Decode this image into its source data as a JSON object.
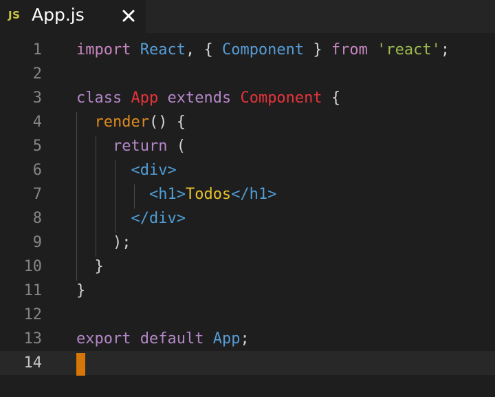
{
  "tab": {
    "lang_badge": "JS",
    "title": "App.js",
    "close_icon": "close-icon"
  },
  "editor": {
    "current_line": 14,
    "lines": [
      {
        "n": "1",
        "tokens": [
          {
            "t": "import",
            "c": "kw"
          },
          {
            "t": " ",
            "c": "pn"
          },
          {
            "t": "React",
            "c": "id"
          },
          {
            "t": ", { ",
            "c": "pn"
          },
          {
            "t": "Component",
            "c": "id"
          },
          {
            "t": " } ",
            "c": "pn"
          },
          {
            "t": "from",
            "c": "kw"
          },
          {
            "t": " ",
            "c": "pn"
          },
          {
            "t": "'react'",
            "c": "str"
          },
          {
            "t": ";",
            "c": "pn"
          }
        ]
      },
      {
        "n": "2",
        "tokens": []
      },
      {
        "n": "3",
        "tokens": [
          {
            "t": "class",
            "c": "kw2"
          },
          {
            "t": " ",
            "c": "pn"
          },
          {
            "t": "App",
            "c": "cls"
          },
          {
            "t": " ",
            "c": "pn"
          },
          {
            "t": "extends",
            "c": "kw2"
          },
          {
            "t": " ",
            "c": "pn"
          },
          {
            "t": "Component",
            "c": "cls"
          },
          {
            "t": " {",
            "c": "pn"
          }
        ]
      },
      {
        "n": "4",
        "tokens": [
          {
            "t": "  ",
            "c": "pn"
          },
          {
            "t": "render",
            "c": "fn"
          },
          {
            "t": "() {",
            "c": "pn"
          }
        ]
      },
      {
        "n": "5",
        "tokens": [
          {
            "t": "    ",
            "c": "pn"
          },
          {
            "t": "return",
            "c": "kw2"
          },
          {
            "t": " (",
            "c": "pn"
          }
        ]
      },
      {
        "n": "6",
        "tokens": [
          {
            "t": "      ",
            "c": "pn"
          },
          {
            "t": "<div>",
            "c": "tag"
          }
        ]
      },
      {
        "n": "7",
        "tokens": [
          {
            "t": "        ",
            "c": "pn"
          },
          {
            "t": "<h1>",
            "c": "tag"
          },
          {
            "t": "Todos",
            "c": "txt"
          },
          {
            "t": "</h1>",
            "c": "tag"
          }
        ]
      },
      {
        "n": "8",
        "tokens": [
          {
            "t": "      ",
            "c": "pn"
          },
          {
            "t": "</div>",
            "c": "tag"
          }
        ]
      },
      {
        "n": "9",
        "tokens": [
          {
            "t": "    );",
            "c": "pn"
          }
        ]
      },
      {
        "n": "10",
        "tokens": [
          {
            "t": "  }",
            "c": "pn"
          }
        ]
      },
      {
        "n": "11",
        "tokens": [
          {
            "t": "}",
            "c": "pn"
          }
        ]
      },
      {
        "n": "12",
        "tokens": []
      },
      {
        "n": "13",
        "tokens": [
          {
            "t": "export",
            "c": "kw2"
          },
          {
            "t": " ",
            "c": "pn"
          },
          {
            "t": "default",
            "c": "kw2"
          },
          {
            "t": " ",
            "c": "pn"
          },
          {
            "t": "App",
            "c": "id"
          },
          {
            "t": ";",
            "c": "pn"
          }
        ]
      },
      {
        "n": "14",
        "tokens": []
      }
    ]
  }
}
